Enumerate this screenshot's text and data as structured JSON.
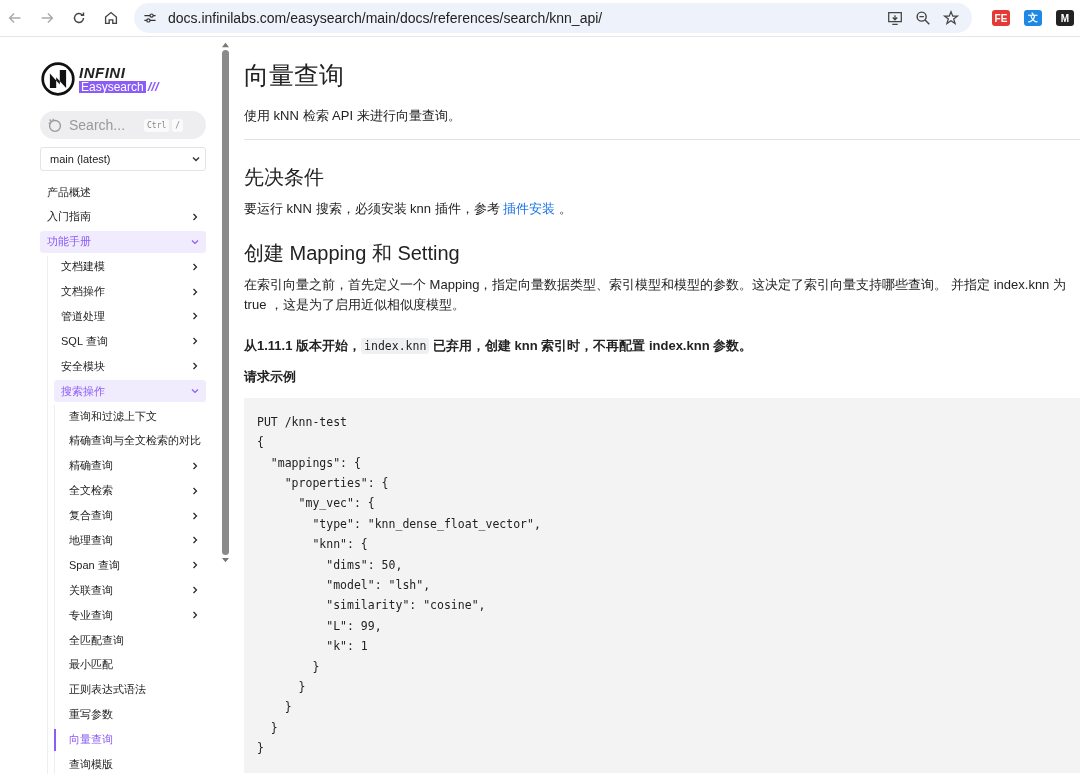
{
  "browser": {
    "url": "docs.infinilabs.com/easysearch/main/docs/references/search/knn_api/",
    "extensions": [
      {
        "label": "FE",
        "color": "#e53935"
      },
      {
        "label": "文",
        "color": "#1e88e5"
      },
      {
        "label": "M",
        "color": "#222222"
      }
    ]
  },
  "sidebar": {
    "logo": {
      "brand": "INFINI",
      "product": "Easysearch",
      "slashes": "///"
    },
    "search": {
      "placeholder": "Search...",
      "keys": [
        "Ctrl",
        "/"
      ]
    },
    "version": "main (latest)",
    "nav": [
      {
        "label": "产品概述",
        "selected": false
      },
      {
        "label": "入门指南",
        "selected": false,
        "expanded": false
      },
      {
        "label": "功能手册",
        "selected": false,
        "expanded": true,
        "children": [
          {
            "label": "文档建模",
            "selected": false,
            "expanded": false
          },
          {
            "label": "文档操作",
            "selected": false,
            "expanded": false
          },
          {
            "label": "管道处理",
            "selected": false,
            "expanded": false
          },
          {
            "label": "SQL 查询",
            "selected": false,
            "expanded": false
          },
          {
            "label": "安全模块",
            "selected": false,
            "expanded": false
          },
          {
            "label": "搜索操作",
            "selected": false,
            "expanded": true,
            "children": [
              {
                "label": "查询和过滤上下文",
                "selected": false
              },
              {
                "label": "精确查询与全文检索的对比",
                "selected": false
              },
              {
                "label": "精确查询",
                "selected": false,
                "expanded": false
              },
              {
                "label": "全文检索",
                "selected": false,
                "expanded": false
              },
              {
                "label": "复合查询",
                "selected": false,
                "expanded": false
              },
              {
                "label": "地理查询",
                "selected": false,
                "expanded": false
              },
              {
                "label": "Span 查询",
                "selected": false,
                "expanded": false
              },
              {
                "label": "关联查询",
                "selected": false,
                "expanded": false
              },
              {
                "label": "专业查询",
                "selected": false,
                "expanded": false
              },
              {
                "label": "全匹配查询",
                "selected": false
              },
              {
                "label": "最小匹配",
                "selected": false
              },
              {
                "label": "正则表达式语法",
                "selected": false
              },
              {
                "label": "重写参数",
                "selected": false
              },
              {
                "label": "向量查询",
                "selected": true
              },
              {
                "label": "查询模版",
                "selected": false
              }
            ]
          }
        ]
      }
    ]
  },
  "content": {
    "title": "向量查询",
    "intro": "使用 kNN 检索 API 来进行向量查询。",
    "sections": [
      {
        "heading": "先决条件",
        "parts": [
          {
            "kind": "text",
            "text": "要运行 kNN 搜索，必须安装 knn 插件，参考 "
          },
          {
            "kind": "link",
            "text": "插件安装"
          },
          {
            "kind": "text",
            "text": " 。"
          }
        ]
      },
      {
        "heading": "创建 Mapping 和 Setting",
        "parts": [
          {
            "kind": "text",
            "text": "在索引向量之前，首先定义一个 Mapping，指定向量数据类型、索引模型和模型的参数。这决定了索引向量支持哪些查询。 并指定 index.knn 为 true ，这是为了启用近似相似度模型。"
          }
        ]
      }
    ],
    "note": [
      {
        "kind": "text",
        "text": "从1.11.1 版本开始，"
      },
      {
        "kind": "code",
        "text": "index.knn"
      },
      {
        "kind": "text",
        "text": " 已弃用，创建 knn 索引时，不再配置 index.knn 参数。"
      }
    ],
    "example_title": "请求示例",
    "code": [
      "PUT /knn-test",
      "{",
      "  \"mappings\": {",
      "    \"properties\": {",
      "      \"my_vec\": {",
      "        \"type\": \"knn_dense_float_vector\",",
      "        \"knn\": {",
      "          \"dims\": 50,",
      "          \"model\": \"lsh\",",
      "          \"similarity\": \"cosine\",",
      "          \"L\": 99,",
      "          \"k\": 1",
      "        }",
      "      }",
      "    }",
      "  }",
      "}"
    ]
  }
}
